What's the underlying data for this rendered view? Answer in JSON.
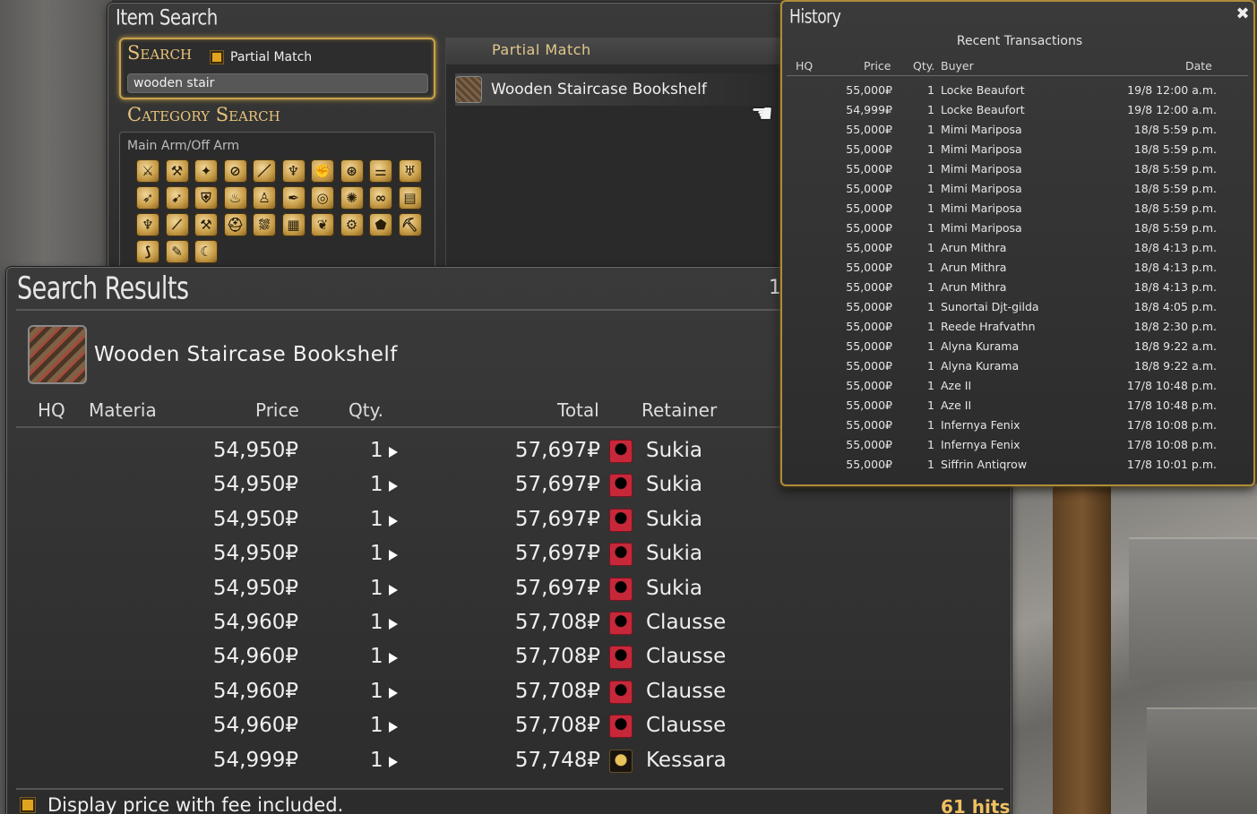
{
  "item_search": {
    "title": "Item Search",
    "search_heading": "Search",
    "partial_match_label": "Partial Match",
    "search_value": "wooden stair",
    "category_heading": "Category Search",
    "category_label": "Main Arm/Off Arm",
    "match_header": "Partial Match",
    "match_item": "Wooden Staircase Bookshelf"
  },
  "search_results": {
    "title": "Search Results",
    "page": "1",
    "item_name": "Wooden Staircase Bookshelf",
    "columns": {
      "hq": "HQ",
      "materia": "Materia",
      "price": "Price",
      "qty": "Qty.",
      "total": "Total",
      "retainer": "Retainer"
    },
    "rows": [
      {
        "price": "54,950₽",
        "qty": "1",
        "total": "57,697₽",
        "retainer": "Sukia"
      },
      {
        "price": "54,950₽",
        "qty": "1",
        "total": "57,697₽",
        "retainer": "Sukia"
      },
      {
        "price": "54,950₽",
        "qty": "1",
        "total": "57,697₽",
        "retainer": "Sukia"
      },
      {
        "price": "54,950₽",
        "qty": "1",
        "total": "57,697₽",
        "retainer": "Sukia"
      },
      {
        "price": "54,950₽",
        "qty": "1",
        "total": "57,697₽",
        "retainer": "Sukia"
      },
      {
        "price": "54,960₽",
        "qty": "1",
        "total": "57,708₽",
        "retainer": "Clausse"
      },
      {
        "price": "54,960₽",
        "qty": "1",
        "total": "57,708₽",
        "retainer": "Clausse"
      },
      {
        "price": "54,960₽",
        "qty": "1",
        "total": "57,708₽",
        "retainer": "Clausse"
      },
      {
        "price": "54,960₽",
        "qty": "1",
        "total": "57,708₽",
        "retainer": "Clausse"
      },
      {
        "price": "54,999₽",
        "qty": "1",
        "total": "57,748₽",
        "retainer": "Kessara"
      }
    ],
    "footer_label": "Display price with fee included.",
    "hits": "61 hits"
  },
  "history": {
    "title": "History",
    "subtitle": "Recent Transactions",
    "columns": {
      "hq": "HQ",
      "price": "Price",
      "qty": "Qty.",
      "buyer": "Buyer",
      "date": "Date"
    },
    "rows": [
      {
        "price": "55,000₽",
        "qty": "1",
        "buyer": "Locke Beaufort",
        "date": "19/8 12:00 a.m."
      },
      {
        "price": "54,999₽",
        "qty": "1",
        "buyer": "Locke Beaufort",
        "date": "19/8 12:00 a.m."
      },
      {
        "price": "55,000₽",
        "qty": "1",
        "buyer": "Mimi Mariposa",
        "date": "18/8 5:59 p.m."
      },
      {
        "price": "55,000₽",
        "qty": "1",
        "buyer": "Mimi Mariposa",
        "date": "18/8 5:59 p.m."
      },
      {
        "price": "55,000₽",
        "qty": "1",
        "buyer": "Mimi Mariposa",
        "date": "18/8 5:59 p.m."
      },
      {
        "price": "55,000₽",
        "qty": "1",
        "buyer": "Mimi Mariposa",
        "date": "18/8 5:59 p.m."
      },
      {
        "price": "55,000₽",
        "qty": "1",
        "buyer": "Mimi Mariposa",
        "date": "18/8 5:59 p.m."
      },
      {
        "price": "55,000₽",
        "qty": "1",
        "buyer": "Mimi Mariposa",
        "date": "18/8 5:59 p.m."
      },
      {
        "price": "55,000₽",
        "qty": "1",
        "buyer": "Arun Mithra",
        "date": "18/8 4:13 p.m."
      },
      {
        "price": "55,000₽",
        "qty": "1",
        "buyer": "Arun Mithra",
        "date": "18/8 4:13 p.m."
      },
      {
        "price": "55,000₽",
        "qty": "1",
        "buyer": "Arun Mithra",
        "date": "18/8 4:13 p.m."
      },
      {
        "price": "55,000₽",
        "qty": "1",
        "buyer": "Sunortai Djt-gilda",
        "date": "18/8 4:05 p.m."
      },
      {
        "price": "55,000₽",
        "qty": "1",
        "buyer": "Reede Hrafvathn",
        "date": "18/8 2:30 p.m."
      },
      {
        "price": "55,000₽",
        "qty": "1",
        "buyer": "Alyna Kurama",
        "date": "18/8 9:22 a.m."
      },
      {
        "price": "55,000₽",
        "qty": "1",
        "buyer": "Alyna Kurama",
        "date": "18/8 9:22 a.m."
      },
      {
        "price": "55,000₽",
        "qty": "1",
        "buyer": "Aze II",
        "date": "17/8 10:48 p.m."
      },
      {
        "price": "55,000₽",
        "qty": "1",
        "buyer": "Aze II",
        "date": "17/8 10:48 p.m."
      },
      {
        "price": "55,000₽",
        "qty": "1",
        "buyer": "Infernya Fenix",
        "date": "17/8 10:08 p.m."
      },
      {
        "price": "55,000₽",
        "qty": "1",
        "buyer": "Infernya Fenix",
        "date": "17/8 10:08 p.m."
      },
      {
        "price": "55,000₽",
        "qty": "1",
        "buyer": "Siffrin Antiqrow",
        "date": "17/8 10:01 p.m."
      }
    ]
  },
  "icons": {
    "category_icons": [
      "crossed-swords-icon",
      "axe-icon",
      "lance-icon",
      "bow-icon",
      "sword-icon",
      "staff-icon",
      "glove-icon",
      "chakram-icon",
      "dagger-icon",
      "fork-icon",
      "bow2-icon",
      "arrow-icon",
      "shield-icon",
      "flame-icon",
      "figure-icon",
      "quill-icon",
      "orb-icon",
      "star-icon",
      "sigil-icon",
      "book-icon",
      "trident-icon",
      "rod-icon",
      "anvil-icon",
      "helm-icon",
      "fish-icon",
      "cube-icon",
      "leaf-icon",
      "gear-icon",
      "rock-icon",
      "pickaxe-icon",
      "feather-icon",
      "pen-icon",
      "sickle-icon"
    ],
    "accent_gold": "#c9a24a",
    "hits_color": "#f0c060"
  }
}
